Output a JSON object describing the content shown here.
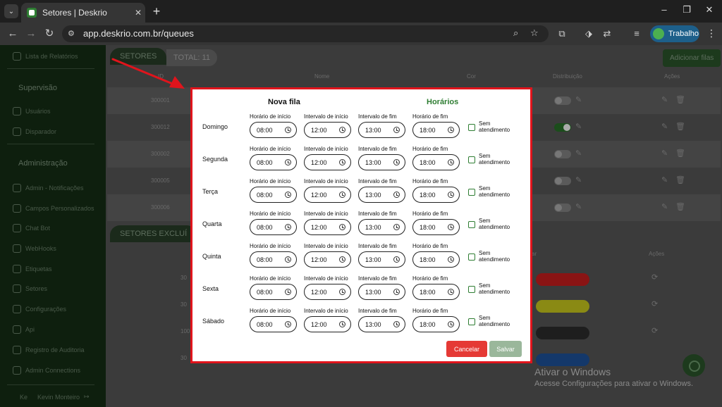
{
  "browser": {
    "tab_title": "Setores | Deskrio",
    "tab_close": "✕",
    "new_tab": "+",
    "url": "app.deskrio.com.br/queues",
    "profile_name": "Trabalho",
    "accent": "#1d5f8a"
  },
  "sidebar": {
    "items": [
      {
        "label": "Lista de Relatórios"
      },
      {
        "label": "Usuários"
      },
      {
        "label": "Disparador"
      },
      {
        "label": "Admin - Notificações"
      },
      {
        "label": "Campos Personalizados"
      },
      {
        "label": "Chat Bot"
      },
      {
        "label": "WebHooks"
      },
      {
        "label": "Etiquetas"
      },
      {
        "label": "Setores"
      },
      {
        "label": "Configurações"
      },
      {
        "label": "Api"
      },
      {
        "label": "Registro de Auditoria"
      },
      {
        "label": "Admin Connections"
      }
    ],
    "section_supervisao": "Supervisão",
    "section_admin": "Administração",
    "user_prefix": "Ke",
    "user_name": "Kevin Monteiro"
  },
  "backdrop": {
    "setores_tab": "SETORES",
    "total_label": "TOTAL: 11",
    "add_button": "Adicionar filas",
    "excluded_tab": "SETORES EXCLUÍ",
    "col_id": "ID",
    "col_nome": "Nome",
    "col_cor": "Cor",
    "col_distribuicao": "Distribuição",
    "col_acoes": "Ações",
    "col_cor2": "ar",
    "col_acoes2": "Ações",
    "rows": [
      {
        "id": "300001",
        "toggle_on": false
      },
      {
        "id": "300012",
        "toggle_on": true
      },
      {
        "id": "300002",
        "toggle_on": false
      },
      {
        "id": "300005",
        "toggle_on": false
      },
      {
        "id": "300006",
        "toggle_on": false
      }
    ],
    "excluded_rows": [
      {
        "id": "30",
        "color": "#8a1414"
      },
      {
        "id": "30",
        "color": "#8a8a14"
      },
      {
        "id": "100",
        "color": "#1e1e1e"
      },
      {
        "id": "30",
        "color": "#14386a"
      }
    ]
  },
  "watermark": {
    "line1": "Ativar o Windows",
    "line2": "Acesse Configurações para ativar o Windows."
  },
  "modal": {
    "title": "Nova fila",
    "subtitle": "Horários",
    "label_inicio": "Horário de início",
    "label_int_inicio": "Intervalo de início",
    "label_int_fim": "Intervalo de fim",
    "label_fim": "Horário de fim",
    "sem_atendimento": "Sem atendimento",
    "days": [
      {
        "name": "Domingo",
        "start": "08:00",
        "break_start": "12:00",
        "break_end": "13:00",
        "end": "18:00"
      },
      {
        "name": "Segunda",
        "start": "08:00",
        "break_start": "12:00",
        "break_end": "13:00",
        "end": "18:00"
      },
      {
        "name": "Terça",
        "start": "08:00",
        "break_start": "12:00",
        "break_end": "13:00",
        "end": "18:00"
      },
      {
        "name": "Quarta",
        "start": "08:00",
        "break_start": "12:00",
        "break_end": "13:00",
        "end": "18:00"
      },
      {
        "name": "Quinta",
        "start": "08:00",
        "break_start": "12:00",
        "break_end": "13:00",
        "end": "18:00"
      },
      {
        "name": "Sexta",
        "start": "08:00",
        "break_start": "12:00",
        "break_end": "13:00",
        "end": "18:00"
      },
      {
        "name": "Sábado",
        "start": "08:00",
        "break_start": "12:00",
        "break_end": "13:00",
        "end": "18:00"
      }
    ],
    "cancel_label": "Cancelar",
    "save_label": "Salvar",
    "cancel_color": "#e53935",
    "save_color": "#9ab79b",
    "border_color": "#e0141c"
  }
}
